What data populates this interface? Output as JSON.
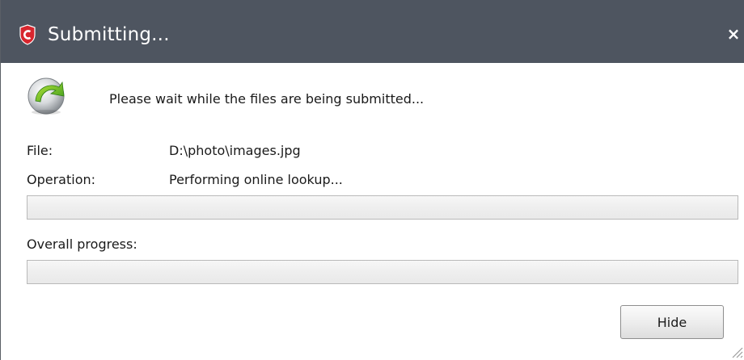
{
  "window": {
    "title": "Submitting...",
    "close_glyph": "×",
    "app_icon": "comodo-shield-icon",
    "accent_color": "#d7262e",
    "titlebar_color": "#4e5560"
  },
  "message": "Please wait while the files are being submitted...",
  "status_icon": "globe-refresh-icon",
  "fields": {
    "file_label": "File:",
    "file_value": "D:\\photo\\images.jpg",
    "operation_label": "Operation:",
    "operation_value": "Performing online lookup..."
  },
  "progress": {
    "current": 0,
    "overall_label": "Overall progress:",
    "overall": 0
  },
  "buttons": {
    "hide_label": "Hide"
  }
}
